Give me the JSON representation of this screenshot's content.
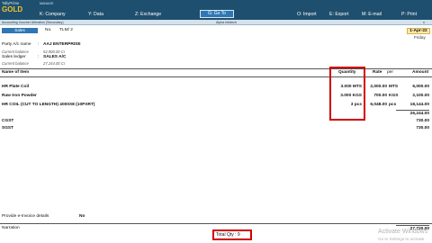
{
  "brand": {
    "app": "TallyPrime",
    "edition": "GOLD",
    "manage": "MANAGE"
  },
  "menu": {
    "company": "K: Company",
    "data": "Y: Data",
    "exchange": "Z: Exchange",
    "goto": "G: Go To",
    "import": "O: Import",
    "export": "E: Export",
    "email": "M: E-mail",
    "print": "P: Print"
  },
  "subheader": {
    "left": "Accounting Voucher Alteration (Secondary)",
    "center": "Alpha Infotech",
    "close": "x"
  },
  "voucher": {
    "type": "Sales",
    "no_label": "No.",
    "no_value": "TLM/ 2",
    "date": "1-Apr-22",
    "weekday": "Friday"
  },
  "party": {
    "account_label": "Party A/c name",
    "account_value": "AAJ ENTERPRISE",
    "balance_label": "Current balance",
    "balance_value": "52,900.00 Cr",
    "ledger_label": "Sales ledger",
    "ledger_value": "SALES A/C",
    "ledger_balance_label": "Current balance",
    "ledger_balance_value": "27,244.00 Cr"
  },
  "columns": {
    "name": "Name of Item",
    "quantity": "Quantity",
    "rate": "Rate",
    "per": "per",
    "amount": "Amount"
  },
  "items": [
    {
      "name": "HR Plate Coil",
      "qty": "3.000 MTS",
      "rate": "2,000.00",
      "per": "MTS",
      "amount": "6,000.00"
    },
    {
      "name": "Raw Iron Powder",
      "qty": "3.000 KGS",
      "rate": "700.00",
      "per": "KGS",
      "amount": "2,100.00"
    },
    {
      "name": "HR COIL (CUT TO LENGTH) 4000X8 (10PXRT)",
      "qty": "3 pcs",
      "rate": "6,048.00",
      "per": "pcs",
      "amount": "18,144.00"
    }
  ],
  "subtotal": "26,244.00",
  "taxes": [
    {
      "name": "CGST",
      "amount": "730.00"
    },
    {
      "name": "SGST",
      "amount": "730.00"
    }
  ],
  "einvoice": {
    "label": "Provide e-Invoice details",
    "value": "No"
  },
  "narration": {
    "label": "Narration"
  },
  "grand_total": "27,720.00",
  "total_qty": "Total Qty : 9",
  "watermark": {
    "line1": "Activate Windows",
    "line2": "Go to Settings to activate"
  }
}
